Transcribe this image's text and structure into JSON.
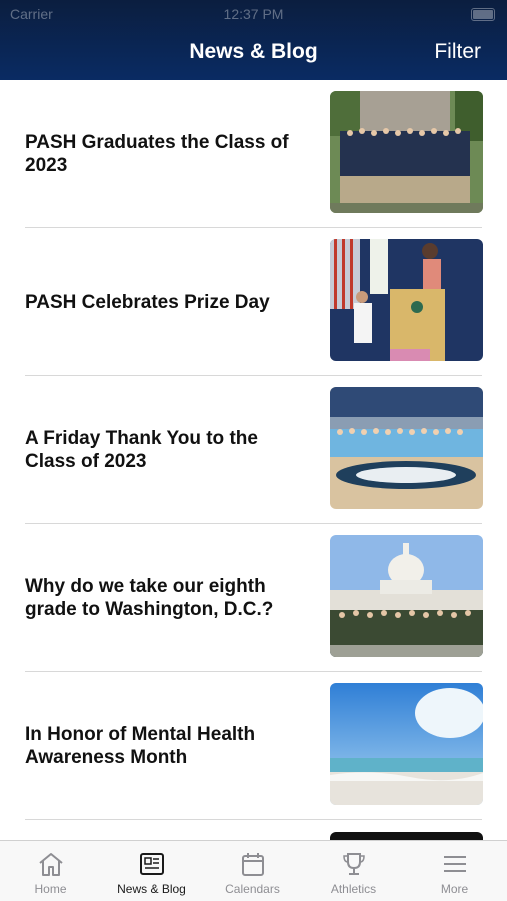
{
  "status_bar": {
    "carrier": "Carrier",
    "time": "12:37 PM"
  },
  "header": {
    "title": "News & Blog",
    "filter_label": "Filter"
  },
  "articles": [
    {
      "title": "PASH Graduates the Class of 2023"
    },
    {
      "title": "PASH Celebrates Prize Day"
    },
    {
      "title": "A Friday Thank You to the Class of 2023"
    },
    {
      "title": "Why do we take our eighth grade to Washington, D.C.?"
    },
    {
      "title": "In Honor of Mental Health Awareness Month"
    }
  ],
  "tabs": [
    {
      "label": "Home",
      "icon": "home-icon"
    },
    {
      "label": "News & Blog",
      "icon": "newspaper-icon",
      "active": true
    },
    {
      "label": "Calendars",
      "icon": "calendar-icon"
    },
    {
      "label": "Athletics",
      "icon": "trophy-icon"
    },
    {
      "label": "More",
      "icon": "menu-icon"
    }
  ],
  "colors": {
    "header_top": "#0b1e3f",
    "header_bottom": "#0a2b63",
    "tab_active": "#1a1a1a",
    "tab_inactive": "#8e8e93"
  }
}
